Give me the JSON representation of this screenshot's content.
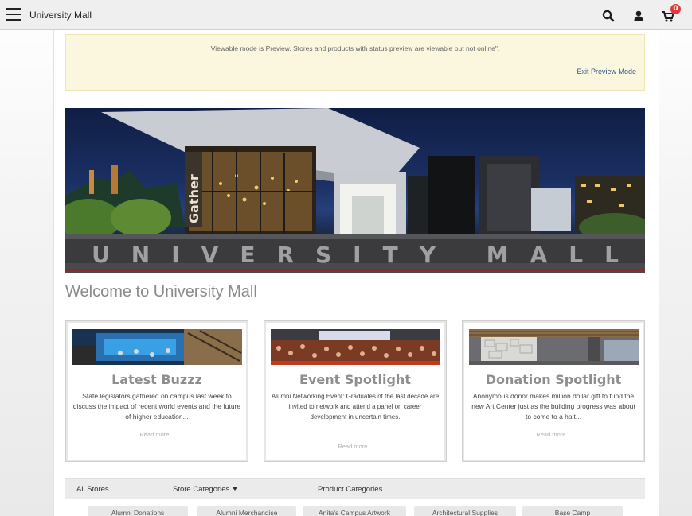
{
  "app": {
    "title": "University Mall"
  },
  "topbar": {
    "menu_icon": "hamburger-icon",
    "search_icon": "search-icon",
    "user_icon": "user-icon",
    "cart_icon": "cart-icon",
    "cart_count": "0"
  },
  "notice": {
    "text": "Viewable mode is Preview. Stores and products with status preview are viewable but not online\".",
    "exit_label": "Exit Preview Mode"
  },
  "hero": {
    "banner_text": "UNIVERSITY MALL",
    "sign_text": "Gather"
  },
  "welcome": {
    "title": "Welcome to University Mall"
  },
  "cards": [
    {
      "title": "Latest Buzzz",
      "description": "State legislators gathered on campus last week to discuss the impact of recent world events and the future of higher education...",
      "read_more": "Read more..."
    },
    {
      "title": "Event Spotlight",
      "description": "Alumni Networking Event: Graduates of the last decade are invited to network and attend a panel on career development in uncertain times.",
      "read_more": "Read more..."
    },
    {
      "title": "Donation Spotlight",
      "description": "Anonymous donor makes million dollar gift to fund the new Art Center just as the building progress was about to come to a halt...",
      "read_more": "Read more..."
    }
  ],
  "storebar": {
    "all_stores": "All Stores",
    "store_categories": "Store Categories",
    "product_categories": "Product Categories"
  },
  "stores": [
    "Alumni Donations",
    "Alumni Merchandise",
    "Anita's Campus Artwork",
    "Architectural Supplies",
    "Base Camp"
  ]
}
